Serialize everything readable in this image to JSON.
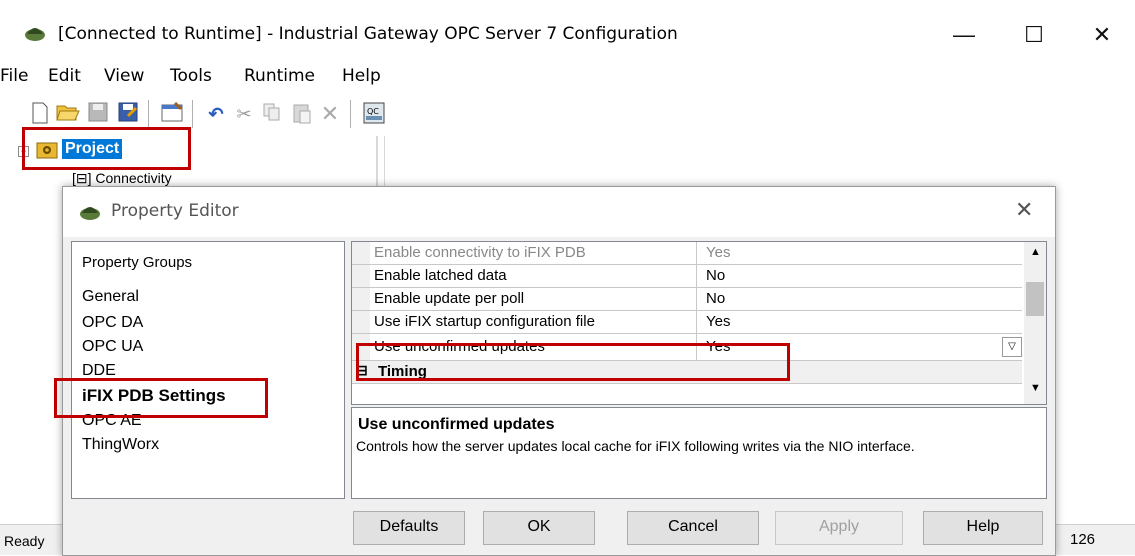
{
  "window": {
    "title": "[Connected to Runtime] - Industrial Gateway OPC Server 7 Configuration",
    "minimize": "—",
    "maximize": "☐",
    "close": "✕"
  },
  "menu": [
    "File",
    "Edit",
    "View",
    "Tools",
    "Runtime",
    "Help"
  ],
  "toolbar": [
    "new-icon",
    "open-icon",
    "save-icon",
    "save-as-icon",
    "properties-icon",
    "undo-icon",
    "cut-icon",
    "copy-icon",
    "paste-icon",
    "delete-icon",
    "quick-client-icon"
  ],
  "tree": {
    "root_label": "Project",
    "child_label": "Connectivity"
  },
  "statusbar": {
    "left": "Ready",
    "right": "126"
  },
  "dialog": {
    "title": "Property Editor",
    "close": "✕",
    "groups_header": "Property Groups",
    "groups": [
      "General",
      "OPC DA",
      "OPC UA",
      "DDE",
      "iFIX PDB Settings",
      "OPC AE",
      "ThingWorx"
    ],
    "selected_group": "iFIX PDB Settings",
    "properties": [
      {
        "name": "Enable connectivity to iFIX PDB",
        "value": "Yes"
      },
      {
        "name": "Enable latched data",
        "value": "No"
      },
      {
        "name": "Enable update per poll",
        "value": "No"
      },
      {
        "name": "Use iFIX startup configuration file",
        "value": "Yes"
      },
      {
        "name": "Use unconfirmed updates",
        "value": "Yes"
      }
    ],
    "section_label": "Timing",
    "description_title": "Use unconfirmed updates",
    "description_text": "Controls how the server updates local cache for iFIX following writes via the NIO interface.",
    "buttons": {
      "defaults": "Defaults",
      "ok": "OK",
      "cancel": "Cancel",
      "apply": "Apply",
      "help": "Help"
    }
  },
  "colors": {
    "highlight": "#c00000",
    "selection": "#0078d7"
  }
}
